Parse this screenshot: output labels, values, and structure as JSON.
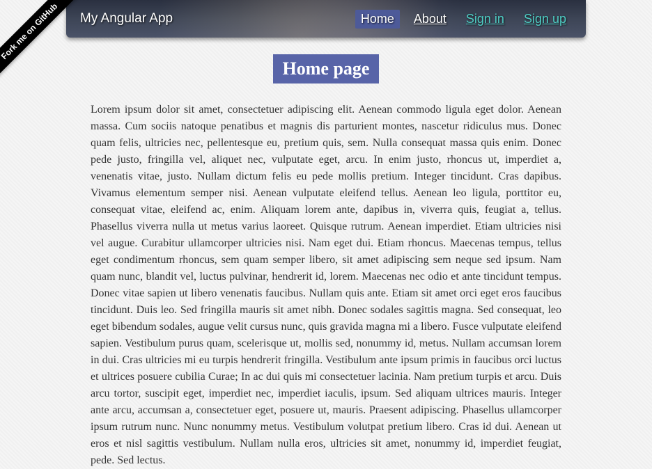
{
  "github_ribbon": "Fork me on GitHub",
  "app_title": "My Angular App",
  "nav": {
    "home": "Home",
    "about": "About",
    "signin": "Sign in",
    "signup": "Sign up"
  },
  "page_title": "Home page",
  "body_text": "Lorem ipsum dolor sit amet, consectetuer adipiscing elit. Aenean commodo ligula eget dolor. Aenean massa. Cum sociis natoque penatibus et magnis dis parturient montes, nascetur ridiculus mus. Donec quam felis, ultricies nec, pellentesque eu, pretium quis, sem. Nulla consequat massa quis enim. Donec pede justo, fringilla vel, aliquet nec, vulputate eget, arcu. In enim justo, rhoncus ut, imperdiet a, venenatis vitae, justo. Nullam dictum felis eu pede mollis pretium. Integer tincidunt. Cras dapibus. Vivamus elementum semper nisi. Aenean vulputate eleifend tellus. Aenean leo ligula, porttitor eu, consequat vitae, eleifend ac, enim. Aliquam lorem ante, dapibus in, viverra quis, feugiat a, tellus. Phasellus viverra nulla ut metus varius laoreet. Quisque rutrum. Aenean imperdiet. Etiam ultricies nisi vel augue. Curabitur ullamcorper ultricies nisi. Nam eget dui. Etiam rhoncus. Maecenas tempus, tellus eget condimentum rhoncus, sem quam semper libero, sit amet adipiscing sem neque sed ipsum. Nam quam nunc, blandit vel, luctus pulvinar, hendrerit id, lorem. Maecenas nec odio et ante tincidunt tempus. Donec vitae sapien ut libero venenatis faucibus. Nullam quis ante. Etiam sit amet orci eget eros faucibus tincidunt. Duis leo. Sed fringilla mauris sit amet nibh. Donec sodales sagittis magna. Sed consequat, leo eget bibendum sodales, augue velit cursus nunc, quis gravida magna mi a libero. Fusce vulputate eleifend sapien. Vestibulum purus quam, scelerisque ut, mollis sed, nonummy id, metus. Nullam accumsan lorem in dui. Cras ultricies mi eu turpis hendrerit fringilla. Vestibulum ante ipsum primis in faucibus orci luctus et ultrices posuere cubilia Curae; In ac dui quis mi consectetuer lacinia. Nam pretium turpis et arcu. Duis arcu tortor, suscipit eget, imperdiet nec, imperdiet iaculis, ipsum. Sed aliquam ultrices mauris. Integer ante arcu, accumsan a, consectetuer eget, posuere ut, mauris. Praesent adipiscing. Phasellus ullamcorper ipsum rutrum nunc. Nunc nonummy metus. Vestibulum volutpat pretium libero. Cras id dui. Aenean ut eros et nisl sagittis vestibulum. Nullam nulla eros, ultricies sit amet, nonummy id, imperdiet feugiat, pede. Sed lectus."
}
